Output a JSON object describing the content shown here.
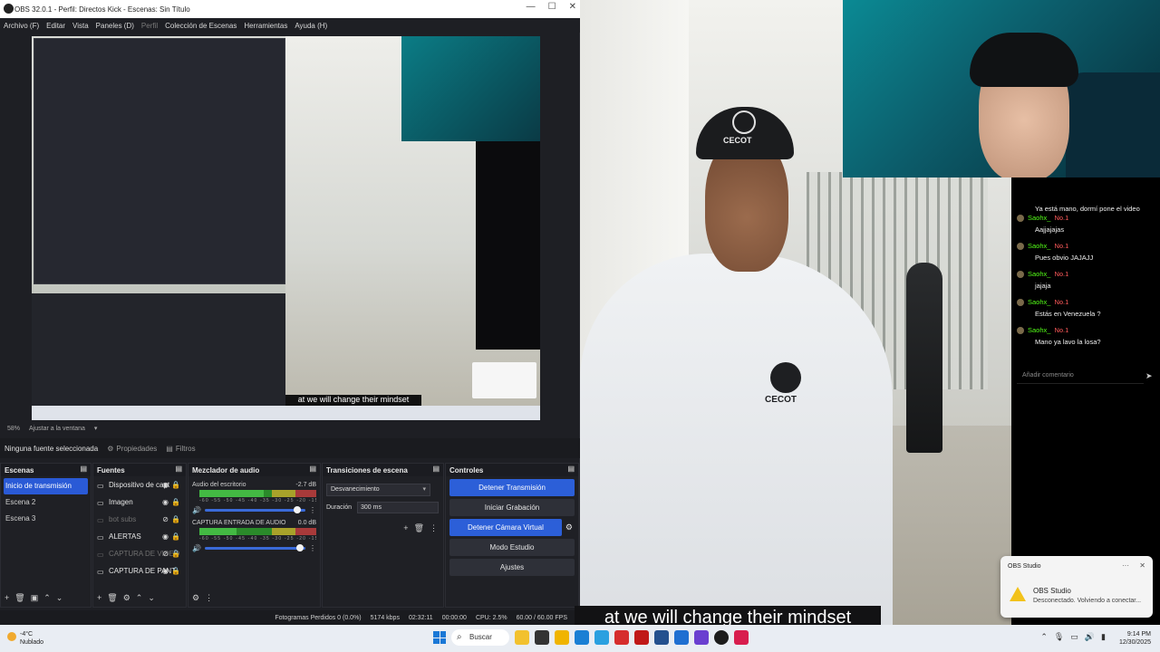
{
  "window": {
    "title": "OBS 32.0.1 - Perfil: Directos Kick - Escenas: Sin Título",
    "min": "—",
    "max": "☐",
    "close": "✕"
  },
  "menu": [
    "Archivo (F)",
    "Editar",
    "Vista",
    "Paneles (D)",
    "Perfil",
    "Colección de Escenas",
    "Herramientas",
    "Ayuda (H)"
  ],
  "preview": {
    "caption": "at we will change their mindset",
    "zoom": "58%",
    "fit_label": "Ajustar a la ventana"
  },
  "source_bar": {
    "none_selected": "Ninguna fuente seleccionada",
    "properties": "Propiedades",
    "filters": "Filtros"
  },
  "scenes": {
    "title": "Escenas",
    "items": [
      "Inicio de transmisión",
      "Escena 2",
      "Escena 3"
    ]
  },
  "sources": {
    "title": "Fuentes",
    "items": [
      {
        "label": "Dispositivo de capt",
        "dim": false
      },
      {
        "label": "Imagen",
        "dim": false
      },
      {
        "label": "bot subs",
        "dim": true
      },
      {
        "label": "ALERTAS",
        "dim": false
      },
      {
        "label": "CAPTURA DE VIDEO",
        "dim": true
      },
      {
        "label": "CAPTURA DE PANT",
        "dim": false
      }
    ]
  },
  "mixer": {
    "title": "Mezclador de audio",
    "channels": [
      {
        "name": "Audio del escritorio",
        "db": "-2.7 dB",
        "level": 0.55
      },
      {
        "name": "CAPTURA ENTRADA DE AUDIO",
        "db": "0.0 dB",
        "level": 0.32
      }
    ],
    "ticks": "-60 -55 -50 -45 -40 -35 -30 -25 -20 -15 -10 -5 0"
  },
  "transitions": {
    "title": "Transiciones de escena",
    "selected": "Desvanecimiento",
    "duration_label": "Duración",
    "duration_value": "300 ms"
  },
  "controls": {
    "title": "Controles",
    "stop_stream": "Detener Transmisión",
    "start_record": "Iniciar Grabación",
    "stop_vcam": "Detener Cámara Virtual",
    "studio_mode": "Modo Estudio",
    "settings": "Ajustes"
  },
  "status": {
    "dropped": "Fotogramas Perdidos 0 (0.0%)",
    "kbps": "5174 kbps",
    "live_time": "02:32:11",
    "rec_time": "00:00:00",
    "cpu": "CPU: 2.5%",
    "fps": "60.00 / 60.00 FPS"
  },
  "stream": {
    "cap_text": "CECOT",
    "chest_text": "CECOT",
    "caption": "at we will change their mindset"
  },
  "chat": {
    "messages": [
      {
        "user": "",
        "badge": "",
        "text": "Ya está mano, dormí pone el video"
      },
      {
        "user": "Saohx_",
        "badge": "No.1",
        "text": "Aajjajajas"
      },
      {
        "user": "Saohx_",
        "badge": "No.1",
        "text": "Pues obvio JAJAJJ"
      },
      {
        "user": "Saohx_",
        "badge": "No.1",
        "text": "jajaja"
      },
      {
        "user": "Saohx_",
        "badge": "No.1",
        "text": "Estás en Venezuela ?"
      },
      {
        "user": "Saohx_",
        "badge": "No.1",
        "text": "Mano ya lavo la losa?"
      }
    ],
    "input_placeholder": "Añadir comentario"
  },
  "toast": {
    "app": "OBS Studio",
    "title": "OBS Studio",
    "message": "Desconectado. Volviendo a conectar..."
  },
  "taskbar": {
    "temp": "-4°C",
    "weather": "Nublado",
    "search": "Buscar",
    "time": "9:14 PM",
    "date": "12/30/2025"
  }
}
